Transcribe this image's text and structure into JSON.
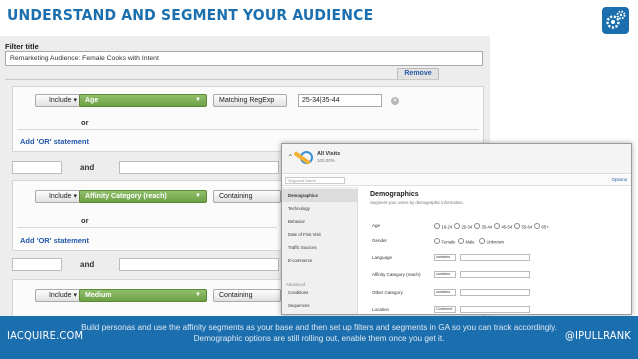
{
  "header": {
    "title": "UNDERSTAND AND SEGMENT YOUR AUDIENCE"
  },
  "filter": {
    "title_label": "Filter title",
    "title_value": "Remarketing Audience: Female Cooks with Intent",
    "remove_label": "Remove",
    "and_label": "and",
    "or_label": "or",
    "add_or_label": "Add 'OR' statement",
    "groups": [
      {
        "include": "Include",
        "dimension": "Age",
        "match": "Matching RegExp",
        "value": "25-34|35-44"
      },
      {
        "include": "Include",
        "dimension": "Affinity Category (reach)",
        "match": "Containing",
        "value": ""
      },
      {
        "include": "Include",
        "dimension": "Medium",
        "match": "Containing",
        "value": ""
      }
    ]
  },
  "overlay": {
    "all_visits": "All Visits",
    "percent": "100.00%",
    "search_placeholder": "Segment Name",
    "options_label": "Options",
    "sidebar": [
      "Demographics",
      "Technology",
      "Behavior",
      "Date of First Visit",
      "Traffic Sources",
      "E-commerce"
    ],
    "advanced_label": "Advanced",
    "advanced_items": [
      "Conditions",
      "Sequences"
    ],
    "title": "Demographics",
    "subtitle": "Segment your users by demographic information.",
    "rows": [
      {
        "label": "Age",
        "options": [
          "18-24",
          "25-34",
          "35-44",
          "45-54",
          "55-64",
          "65+"
        ]
      },
      {
        "label": "Gender",
        "options": [
          "Female",
          "Male",
          "Unknown"
        ]
      },
      {
        "label": "Language",
        "select": "contains"
      },
      {
        "label": "Affinity Category (reach)",
        "select": "contains"
      },
      {
        "label": "Other Category",
        "select": "contains"
      },
      {
        "label": "Location",
        "select": "Continent"
      }
    ]
  },
  "footer": {
    "left": "IACQUIRE.COM",
    "center": "Build personas and use the affinity segments as your base and then set up filters and segments in GA so you can track accordingly.  Demographic options are still rolling out, enable them once you get it.",
    "right": "@IPULLRANK"
  },
  "colors": {
    "brand": "#1c6fae",
    "dimension_green": "#7aad52",
    "link_blue": "#2459a8"
  }
}
